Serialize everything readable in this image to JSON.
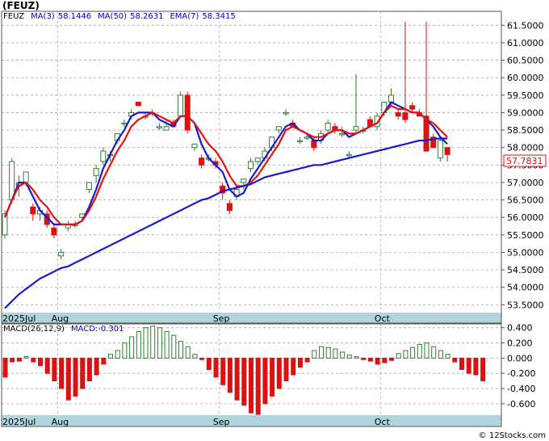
{
  "header": {
    "title": "(FEUZ)",
    "legend": [
      {
        "text": "FEUZ",
        "color": "#000000"
      },
      {
        "text": "MA(3)",
        "color": "#0000cc"
      },
      {
        "text": "58.1446",
        "color": "#0000cc"
      },
      {
        "text": "MA(50)",
        "color": "#0000cc"
      },
      {
        "text": "58.2631",
        "color": "#0000cc"
      },
      {
        "text": "EMA(7)",
        "color": "#0000cc"
      },
      {
        "text": "58.3415",
        "color": "#0000cc"
      }
    ]
  },
  "macd_legend": [
    {
      "text": "MACD(26,12,9)",
      "color": "#000000"
    },
    {
      "text": "MACD:-0.301",
      "color": "#0000cc"
    }
  ],
  "price_tag": "57.7831",
  "copyright": "© 12Stocks.com",
  "colors": {
    "up": "#2e7d32",
    "down": "#dd1111",
    "ma_fast": "#1a1acc",
    "ema": "#e81111",
    "band": "#b0d4de",
    "grid": "#a8a8a8"
  },
  "chart_data": [
    {
      "type": "candlestick",
      "x_labels": [
        "2025Jul",
        "Aug",
        "Sep",
        "Oct"
      ],
      "ylim": [
        53.3,
        61.9
      ],
      "y_ticks": [
        "53.5000",
        "54.0000",
        "54.5000",
        "55.0000",
        "55.5000",
        "56.0000",
        "56.5000",
        "57.0000",
        "57.5000",
        "58.0000",
        "58.5000",
        "59.0000",
        "59.5000",
        "60.0000",
        "60.5000",
        "61.0000",
        "61.5000"
      ],
      "candles": [
        {
          "o": 55.5,
          "h": 56.2,
          "l": 55.4,
          "c": 56.1
        },
        {
          "o": 56.5,
          "h": 57.7,
          "l": 56.4,
          "c": 57.6
        },
        {
          "o": 56.9,
          "h": 57.2,
          "l": 56.6,
          "c": 57.0
        },
        {
          "o": 57.0,
          "h": 57.3,
          "l": 56.9,
          "c": 57.3
        },
        {
          "o": 56.3,
          "h": 56.4,
          "l": 55.9,
          "c": 56.1
        },
        {
          "o": 56.1,
          "h": 56.3,
          "l": 55.9,
          "c": 56.2
        },
        {
          "o": 56.1,
          "h": 56.2,
          "l": 55.7,
          "c": 55.8
        },
        {
          "o": 55.7,
          "h": 55.8,
          "l": 55.4,
          "c": 55.5
        },
        {
          "o": 54.9,
          "h": 55.1,
          "l": 54.8,
          "c": 55.0
        },
        {
          "o": 55.7,
          "h": 55.9,
          "l": 55.6,
          "c": 55.8
        },
        {
          "o": 55.8,
          "h": 55.9,
          "l": 55.7,
          "c": 55.8
        },
        {
          "o": 56.0,
          "h": 56.1,
          "l": 55.9,
          "c": 56.1
        },
        {
          "o": 56.8,
          "h": 57.0,
          "l": 56.7,
          "c": 57.0
        },
        {
          "o": 57.2,
          "h": 57.5,
          "l": 57.0,
          "c": 57.4
        },
        {
          "o": 57.6,
          "h": 58.0,
          "l": 57.5,
          "c": 57.9
        },
        {
          "o": 57.8,
          "h": 57.9,
          "l": 57.6,
          "c": 57.8
        },
        {
          "o": 58.2,
          "h": 58.4,
          "l": 58.1,
          "c": 58.4
        },
        {
          "o": 58.7,
          "h": 58.8,
          "l": 58.6,
          "c": 58.7
        },
        {
          "o": 58.9,
          "h": 59.1,
          "l": 58.8,
          "c": 59.0
        },
        {
          "o": 59.3,
          "h": 59.3,
          "l": 59.2,
          "c": 59.2
        },
        {
          "o": 58.9,
          "h": 59.0,
          "l": 58.8,
          "c": 58.9
        },
        {
          "o": 59.0,
          "h": 59.1,
          "l": 58.9,
          "c": 59.0
        },
        {
          "o": 58.6,
          "h": 58.7,
          "l": 58.5,
          "c": 58.6
        },
        {
          "o": 58.5,
          "h": 58.8,
          "l": 58.5,
          "c": 58.6
        },
        {
          "o": 58.7,
          "h": 58.8,
          "l": 58.6,
          "c": 58.6
        },
        {
          "o": 58.9,
          "h": 59.6,
          "l": 58.9,
          "c": 59.5
        },
        {
          "o": 59.5,
          "h": 59.6,
          "l": 58.4,
          "c": 58.5
        },
        {
          "o": 58.0,
          "h": 58.1,
          "l": 57.9,
          "c": 58.1
        },
        {
          "o": 57.7,
          "h": 57.8,
          "l": 57.4,
          "c": 57.5
        },
        {
          "o": 57.7,
          "h": 57.8,
          "l": 57.6,
          "c": 57.7
        },
        {
          "o": 57.6,
          "h": 57.7,
          "l": 57.4,
          "c": 57.5
        },
        {
          "o": 56.9,
          "h": 57.0,
          "l": 56.5,
          "c": 56.7
        },
        {
          "o": 56.4,
          "h": 56.5,
          "l": 56.1,
          "c": 56.2
        },
        {
          "o": 56.6,
          "h": 56.9,
          "l": 56.5,
          "c": 56.8
        },
        {
          "o": 57.0,
          "h": 57.1,
          "l": 56.8,
          "c": 57.1
        },
        {
          "o": 57.4,
          "h": 57.7,
          "l": 57.3,
          "c": 57.6
        },
        {
          "o": 57.6,
          "h": 57.7,
          "l": 57.5,
          "c": 57.7
        },
        {
          "o": 57.7,
          "h": 58.0,
          "l": 57.6,
          "c": 57.9
        },
        {
          "o": 58.0,
          "h": 58.3,
          "l": 57.9,
          "c": 58.3
        },
        {
          "o": 58.5,
          "h": 58.6,
          "l": 58.4,
          "c": 58.6
        },
        {
          "o": 59.0,
          "h": 59.1,
          "l": 58.9,
          "c": 59.0
        },
        {
          "o": 58.7,
          "h": 58.8,
          "l": 58.6,
          "c": 58.6
        },
        {
          "o": 58.2,
          "h": 58.3,
          "l": 58.1,
          "c": 58.2
        },
        {
          "o": 58.3,
          "h": 58.4,
          "l": 58.2,
          "c": 58.3
        },
        {
          "o": 58.2,
          "h": 58.3,
          "l": 57.9,
          "c": 58.0
        },
        {
          "o": 58.2,
          "h": 58.5,
          "l": 58.1,
          "c": 58.4
        },
        {
          "o": 58.5,
          "h": 58.8,
          "l": 58.4,
          "c": 58.7
        },
        {
          "o": 58.6,
          "h": 58.7,
          "l": 58.4,
          "c": 58.5
        },
        {
          "o": 58.4,
          "h": 58.6,
          "l": 58.3,
          "c": 58.4
        },
        {
          "o": 57.8,
          "h": 57.9,
          "l": 57.7,
          "c": 57.8
        },
        {
          "o": 58.5,
          "h": 60.1,
          "l": 58.4,
          "c": 58.6
        },
        {
          "o": 58.5,
          "h": 58.6,
          "l": 58.4,
          "c": 58.5
        },
        {
          "o": 58.8,
          "h": 58.9,
          "l": 58.6,
          "c": 58.6
        },
        {
          "o": 58.6,
          "h": 59.0,
          "l": 58.5,
          "c": 58.9
        },
        {
          "o": 59.0,
          "h": 59.3,
          "l": 58.9,
          "c": 59.3
        },
        {
          "o": 59.3,
          "h": 59.7,
          "l": 59.2,
          "c": 59.5
        },
        {
          "o": 59.0,
          "h": 59.1,
          "l": 58.8,
          "c": 58.9
        },
        {
          "o": 59.0,
          "h": 61.6,
          "l": 58.7,
          "c": 58.8
        },
        {
          "o": 59.2,
          "h": 59.3,
          "l": 59.0,
          "c": 59.1
        },
        {
          "o": 59.0,
          "h": 59.1,
          "l": 58.9,
          "c": 58.9
        },
        {
          "o": 58.9,
          "h": 61.6,
          "l": 57.9,
          "c": 57.9
        },
        {
          "o": 58.3,
          "h": 58.4,
          "l": 58.0,
          "c": 58.0
        },
        {
          "o": 57.7,
          "h": 58.3,
          "l": 57.6,
          "c": 58.2
        },
        {
          "o": 58.0,
          "h": 58.0,
          "l": 57.6,
          "c": 57.8
        }
      ],
      "series": [
        {
          "name": "MA(3)",
          "values": [
            56.0,
            56.5,
            57.0,
            57.0,
            56.6,
            56.2,
            56.0,
            55.8,
            55.8,
            55.8,
            55.8,
            55.9,
            56.3,
            56.8,
            57.4,
            57.8,
            58.2,
            58.5,
            58.9,
            59.0,
            59.0,
            59.0,
            58.8,
            58.7,
            58.6,
            58.9,
            58.9,
            58.7,
            58.1,
            57.7,
            57.5,
            57.3,
            56.8,
            56.6,
            56.7,
            57.1,
            57.4,
            57.7,
            58.0,
            58.3,
            58.6,
            58.7,
            58.5,
            58.4,
            58.2,
            58.2,
            58.4,
            58.5,
            58.5,
            58.3,
            58.4,
            58.5,
            58.6,
            58.7,
            59.0,
            59.3,
            59.2,
            59.1,
            59.0,
            59.0,
            58.8,
            58.6,
            58.3,
            58.1
          ]
        },
        {
          "name": "EMA(7)",
          "values": [
            56.0,
            56.5,
            56.9,
            57.0,
            56.8,
            56.5,
            56.3,
            56.0,
            55.8,
            55.8,
            55.8,
            55.9,
            56.2,
            56.6,
            57.1,
            57.5,
            57.9,
            58.2,
            58.6,
            58.8,
            58.9,
            59.0,
            58.9,
            58.8,
            58.7,
            58.9,
            58.9,
            58.7,
            58.4,
            58.1,
            57.9,
            57.6,
            57.2,
            56.9,
            56.9,
            57.0,
            57.2,
            57.5,
            57.8,
            58.1,
            58.5,
            58.6,
            58.5,
            58.4,
            58.3,
            58.3,
            58.4,
            58.5,
            58.5,
            58.4,
            58.4,
            58.5,
            58.6,
            58.7,
            59.0,
            59.2,
            59.1,
            59.1,
            59.0,
            59.0,
            58.8,
            58.7,
            58.5,
            58.3
          ]
        },
        {
          "name": "MA(50)",
          "values": [
            53.4,
            53.6,
            53.8,
            53.95,
            54.1,
            54.25,
            54.35,
            54.45,
            54.55,
            54.6,
            54.7,
            54.8,
            54.9,
            55.0,
            55.1,
            55.2,
            55.3,
            55.4,
            55.5,
            55.6,
            55.7,
            55.8,
            55.9,
            56.0,
            56.1,
            56.2,
            56.3,
            56.4,
            56.5,
            56.55,
            56.65,
            56.75,
            56.8,
            56.85,
            56.9,
            56.95,
            57.05,
            57.15,
            57.2,
            57.25,
            57.3,
            57.35,
            57.4,
            57.45,
            57.5,
            57.5,
            57.55,
            57.6,
            57.65,
            57.7,
            57.75,
            57.8,
            57.85,
            57.9,
            57.95,
            58.0,
            58.05,
            58.1,
            58.15,
            58.2,
            58.2,
            58.25,
            58.26,
            58.26
          ]
        }
      ]
    },
    {
      "type": "bar",
      "ylim": [
        -0.75,
        0.45
      ],
      "y_ticks": [
        "0.400",
        "0.200",
        "0.000",
        "-0.200",
        "-0.400",
        "-0.600"
      ],
      "values": [
        -0.25,
        -0.05,
        -0.04,
        0.02,
        -0.05,
        -0.1,
        -0.2,
        -0.3,
        -0.4,
        -0.55,
        -0.5,
        -0.4,
        -0.3,
        -0.22,
        -0.08,
        0.05,
        0.1,
        0.2,
        0.28,
        0.35,
        0.4,
        0.42,
        0.4,
        0.35,
        0.3,
        0.22,
        0.15,
        0.05,
        -0.02,
        -0.15,
        -0.25,
        -0.35,
        -0.45,
        -0.55,
        -0.62,
        -0.72,
        -0.74,
        -0.6,
        -0.5,
        -0.4,
        -0.3,
        -0.22,
        -0.12,
        -0.05,
        0.1,
        0.15,
        0.14,
        0.12,
        0.08,
        0.04,
        0.02,
        -0.02,
        -0.04,
        -0.08,
        -0.06,
        -0.03,
        0.06,
        0.1,
        0.14,
        0.18,
        0.2,
        0.15,
        0.1,
        0.05,
        -0.05,
        -0.15,
        -0.2,
        -0.22,
        -0.3
      ]
    }
  ]
}
